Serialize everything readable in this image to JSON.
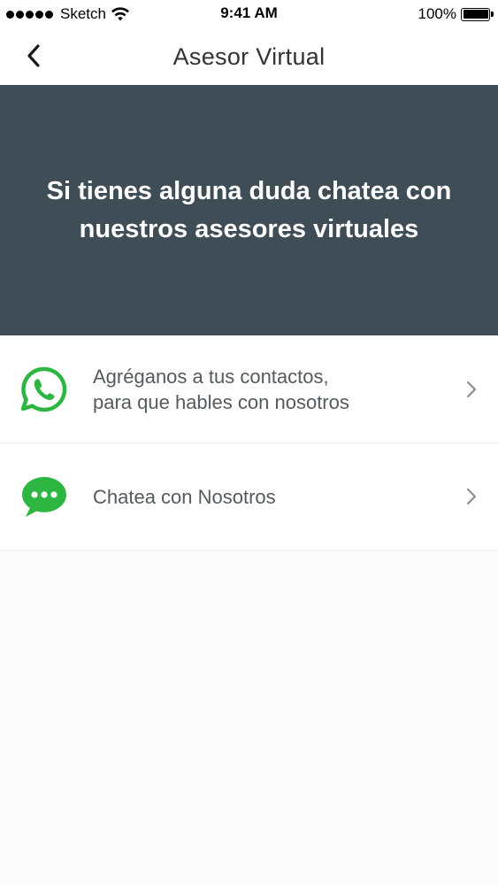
{
  "status_bar": {
    "carrier": "Sketch",
    "time": "9:41 AM",
    "battery": "100%"
  },
  "nav": {
    "title": "Asesor Virtual",
    "back_icon": "chevron-left-icon"
  },
  "hero": {
    "message": "Si tienes alguna duda chatea con nuestros asesores virtuales",
    "background_color": "#3f4d57"
  },
  "options": [
    {
      "label_line1": "Agréganos a tus contactos,",
      "label_line2": "para que hables con nosotros",
      "icon": "whatsapp-icon",
      "icon_color": "#2db742"
    },
    {
      "label": "Chatea con Nosotros",
      "icon": "chat-bubble-icon",
      "icon_color": "#2db742"
    }
  ]
}
